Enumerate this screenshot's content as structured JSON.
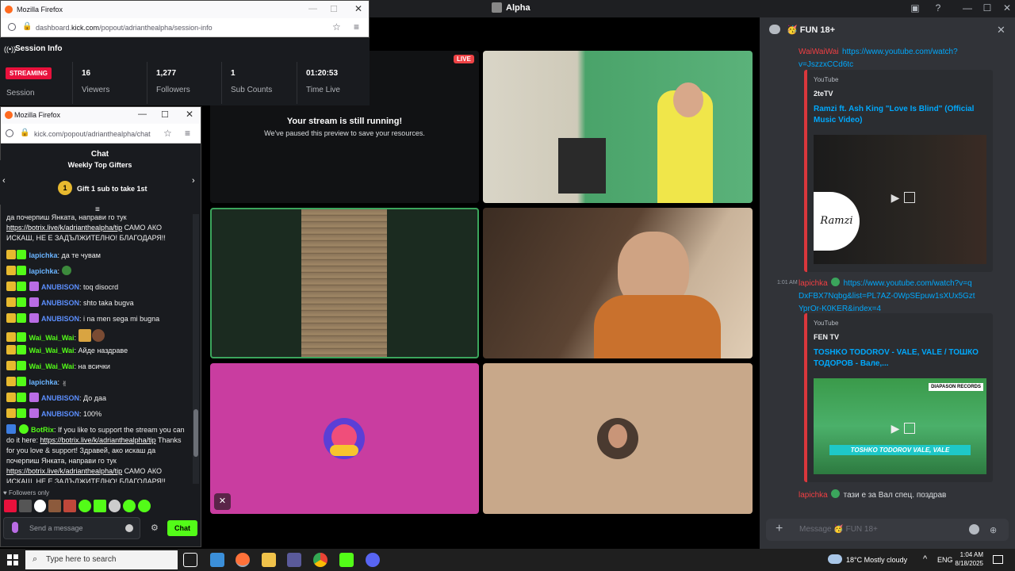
{
  "discord": {
    "app_title": "Alpha",
    "stage": {
      "live_badge": "LIVE",
      "paused_title": "Your stream is still running!",
      "paused_sub": "We've paused this preview to save your resources."
    },
    "channel": {
      "name": "🥳 FUN 18+",
      "messages": [
        {
          "user": "WaiWaiWai",
          "link": "https://www.youtube.com/watch?v=JszzxCCd6tc",
          "embed": {
            "provider": "YouTube",
            "author": "2teTV",
            "title": "Ramzi ft. Ash King \"Love Is Blind\" (Official Music Video)",
            "thumb_logo": "Ramzi"
          }
        },
        {
          "time": "1:01 AM",
          "user": "lapichka",
          "link": "https://www.youtube.com/watch?v=qDxFBX7Nqbg&list=PL7AZ-0WpSEpuw1sXUx5GztYprOr-K0KER&index=4",
          "embed": {
            "provider": "YouTube",
            "author": "FEN TV",
            "title": "TOSHKO TODOROV - VALE, VALE / ТОШКО ТОДОРОВ - Вале,...",
            "thumb_caption": "TOSHKO TODOROV VALE, VALE",
            "thumb_label": "DIAPASON RECORDS"
          }
        },
        {
          "user": "lapichka",
          "text": "тази е за Вал спец. поздрав"
        }
      ],
      "input_placeholder": "Message 🥳 FUN 18+"
    }
  },
  "ff_session": {
    "window_title": "Mozilla Firefox",
    "url_prefix": "dashboard.",
    "url_domain": "kick.com",
    "url_rest": "/popout/adrianthealpha/session-info",
    "heading": "Session Info",
    "status_badge": "STREAMING",
    "session_label": "Session",
    "stats": [
      {
        "value": "16",
        "label": "Viewers"
      },
      {
        "value": "1,277",
        "label": "Followers"
      },
      {
        "value": "1",
        "label": "Sub Counts"
      },
      {
        "value": "01:20:53",
        "label": "Time Live"
      }
    ]
  },
  "ff_chat": {
    "window_title": "Mozilla Firefox",
    "url": "kick.com/popout/adrianthealpha/chat",
    "chat_title": "Chat",
    "gifters_title": "Weekly Top Gifters",
    "gifters_rank": "1",
    "gifters_text": "Gift 1 sub to take 1st",
    "lines": [
      {
        "user": "",
        "text": "да почерпиш Янката, направи го тук ",
        "link": "https://botrix.live/k/adrianthealpha/tip",
        "text2": " САМО АКО ИСКАШ, НЕ Е ЗАДЪЛЖИТЕЛНО! БЛАГОДАРЯ!!"
      },
      {
        "user": "lapichka",
        "text": ": да те чувам"
      },
      {
        "user": "lapichka",
        "text": ":"
      },
      {
        "user": "ANUBISON",
        "text": ": toq disocrd"
      },
      {
        "user": "ANUBISON",
        "text": ": shto taka bugva"
      },
      {
        "user": "ANUBISON",
        "text": ": i na men sega mi bugna"
      },
      {
        "user": "Wai_Wai_Wai",
        "text": ":"
      },
      {
        "user": "Wai_Wai_Wai",
        "text": ": Айде наздраве"
      },
      {
        "user": "Wai_Wai_Wai",
        "text": ": на всички"
      },
      {
        "user": "lapichka",
        "text": ":"
      },
      {
        "user": "ANUBISON",
        "text": ": До даа"
      },
      {
        "user": "ANUBISON",
        "text": ": 100%"
      }
    ],
    "bot_line": {
      "user": "BotRix",
      "text1": ": If you like to support the stream you can do it here: ",
      "link1": "https://botrix.live/k/adrianthealpha/tip",
      "text2": " Thanks for you love & support! Здравей, ако искаш да почерпиш Янката, направи го тук ",
      "link2": "https://botrix.live/k/adrianthealpha/tip",
      "text3": " САМО АКО ИСКАШ, НЕ Е ЗАДЪЛЖИТЕЛНО! БЛАГОДАРЯ!!"
    },
    "followers_only": "Followers only",
    "input_placeholder": "Send a message",
    "chat_button": "Chat"
  },
  "taskbar": {
    "search_placeholder": "Type here to search",
    "weather": "18°C  Mostly cloudy",
    "lang": "ENG",
    "time": "1:04 AM",
    "date": "8/18/2025"
  }
}
